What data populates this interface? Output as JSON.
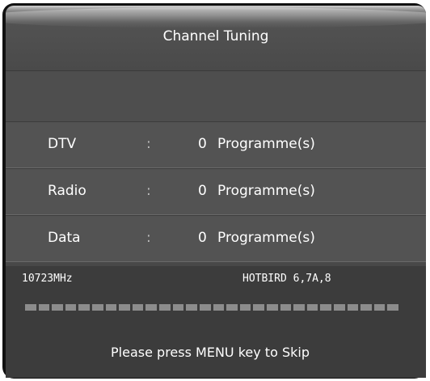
{
  "dialog": {
    "title": "Channel Tuning"
  },
  "results": [
    {
      "label": "DTV",
      "colon": ":",
      "count": "0",
      "unit": "Programme(s)"
    },
    {
      "label": "Radio",
      "colon": ":",
      "count": "0",
      "unit": "Programme(s)"
    },
    {
      "label": "Data",
      "colon": ":",
      "count": "0",
      "unit": "Programme(s)"
    }
  ],
  "status": {
    "frequency": "10723MHz",
    "satellite": "HOTBIRD 6,7A,8",
    "progress_fraction": 0,
    "progress_segments": 28
  },
  "hint": "Please press MENU key to Skip",
  "colors": {
    "panel": "#484848",
    "footer": "#3c3c3c",
    "text": "#ffffff",
    "progress_empty": "#8c8c8c",
    "progress_filled": "#e8e8e8"
  }
}
